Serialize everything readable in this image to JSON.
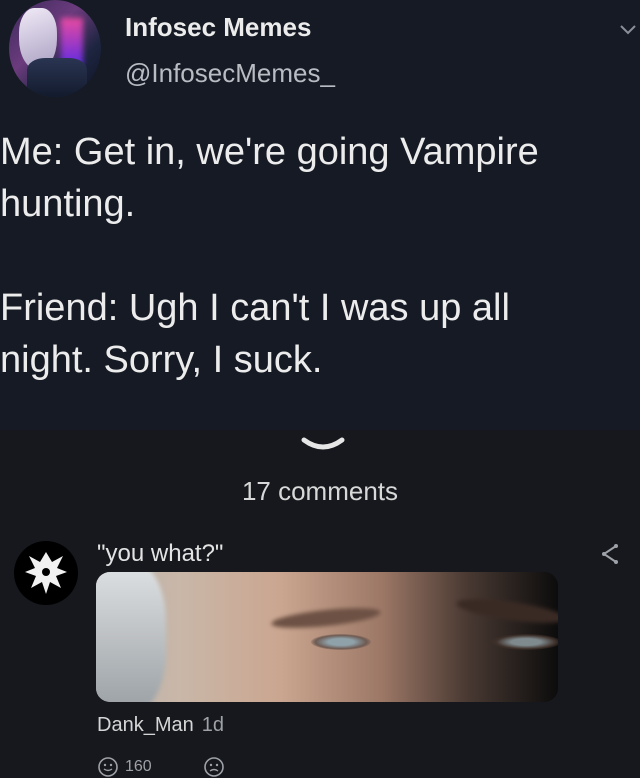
{
  "tweet": {
    "name": "Infosec Memes",
    "handle": "@InfosecMemes_",
    "lines": [
      "Me: Get in, we're going Vampire",
      "hunting.",
      "",
      "Friend: Ugh I can't I was up all",
      "night. Sorry, I suck."
    ]
  },
  "comments_count": "17 comments",
  "comment": {
    "text": "\"you what?\"",
    "author": "Dank_Man",
    "time": "1d",
    "reactions": [
      {
        "icon": "smiley-icon",
        "count": "160"
      },
      {
        "icon": "frown-icon",
        "count": ""
      }
    ]
  },
  "icons": {
    "tweet_menu": "chevron-down-icon",
    "expand": "chevron-down-icon",
    "share": "share-icon"
  },
  "colors": {
    "background": "#16181d",
    "tweet_background": "#151a24",
    "text": "#ececec",
    "muted": "#9ea2a8"
  }
}
